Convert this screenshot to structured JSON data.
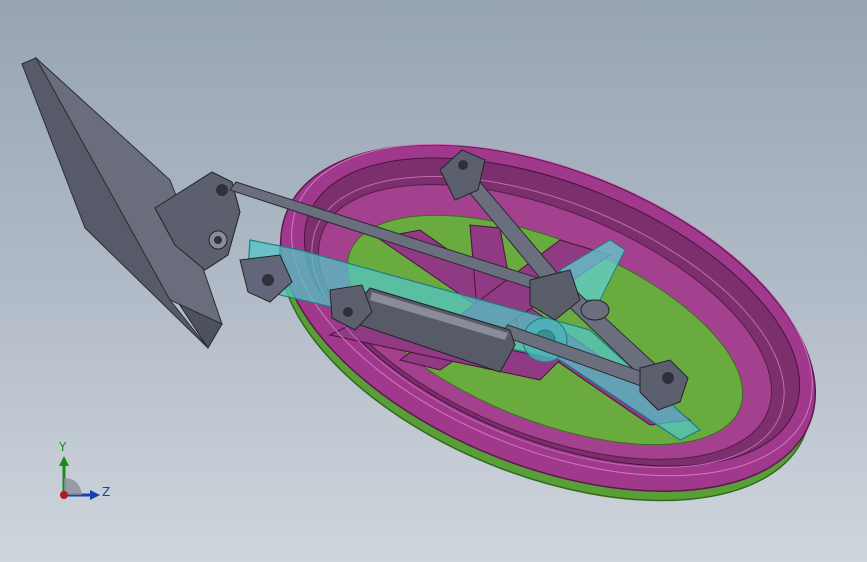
{
  "viewport": {
    "background_top": "#97a4b4",
    "background_bottom": "#cfd5dc"
  },
  "model": {
    "parts": [
      {
        "name": "flat-plate",
        "color": "#6a6e7c"
      },
      {
        "name": "outer-ring",
        "color": "#9b2f86"
      },
      {
        "name": "green-disc",
        "color": "#6aab3f"
      },
      {
        "name": "cyan-arm",
        "color": "#54c4c4"
      },
      {
        "name": "gray-rods",
        "color": "#5c5f6b"
      },
      {
        "name": "cylinder",
        "color": "#585b67"
      }
    ]
  },
  "triad": {
    "y_label": "Y",
    "z_label": "Z",
    "y_color": "#1a8a1a",
    "z_color": "#1a3fb5",
    "x_color": "#b51a1a"
  }
}
